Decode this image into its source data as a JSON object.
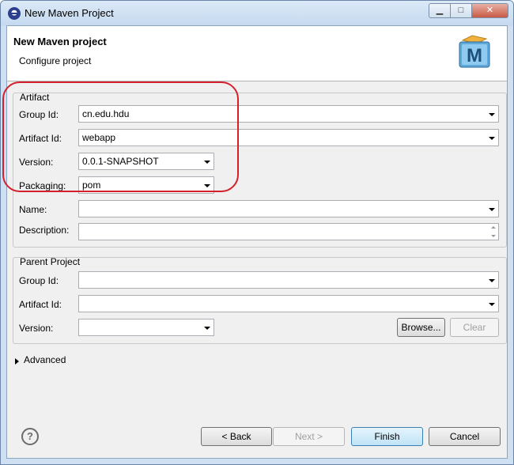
{
  "window": {
    "title": "New Maven Project"
  },
  "header": {
    "title": "New Maven project",
    "subtitle": "Configure project"
  },
  "artifact": {
    "label": "Artifact",
    "group_id": {
      "label": "Group Id:",
      "value": "cn.edu.hdu"
    },
    "artifact_id": {
      "label": "Artifact Id:",
      "value": "webapp"
    },
    "version": {
      "label": "Version:",
      "value": "0.0.1-SNAPSHOT"
    },
    "packaging": {
      "label": "Packaging:",
      "value": "pom"
    },
    "name": {
      "label": "Name:",
      "value": ""
    },
    "description": {
      "label": "Description:",
      "value": ""
    }
  },
  "parent": {
    "label": "Parent Project",
    "group_id": {
      "label": "Group Id:",
      "value": ""
    },
    "artifact_id": {
      "label": "Artifact Id:",
      "value": ""
    },
    "version": {
      "label": "Version:",
      "value": ""
    },
    "browse_label": "Browse...",
    "clear_label": "Clear"
  },
  "advanced": {
    "label": "Advanced"
  },
  "footer": {
    "back_label": "< Back",
    "next_label": "Next >",
    "finish_label": "Finish",
    "cancel_label": "Cancel"
  },
  "icons": {
    "app": "eclipse-icon",
    "logo": "maven-logo-icon",
    "help": "help-icon"
  },
  "colors": {
    "highlight": "#d3202c"
  }
}
